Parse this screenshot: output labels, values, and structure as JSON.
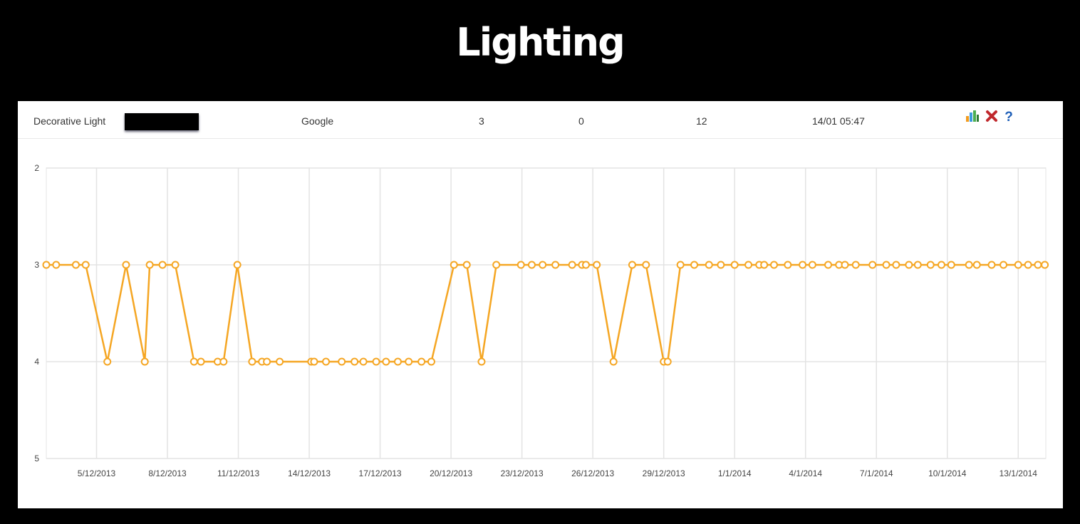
{
  "page_title": "Lighting",
  "row": {
    "name": "Decorative Light",
    "engine": "Google",
    "col3": "3",
    "col4": "0",
    "col5": "12",
    "updated": "14/01 05:47",
    "icons": [
      "bar-chart-icon",
      "close-icon",
      "help-icon"
    ]
  },
  "colors": {
    "series": "#f5a623",
    "background": "#000000",
    "close": "#c0282d",
    "help": "#1f5fb8"
  },
  "chart_data": {
    "type": "line",
    "title": "",
    "xlabel": "",
    "ylabel": "",
    "y_reversed": true,
    "ylim": [
      2,
      5
    ],
    "yticks": [
      "2",
      "3",
      "4",
      "5"
    ],
    "xlim": [
      "2013-12-02T21:00",
      "2014-01-14T04:00"
    ],
    "xticks": [
      {
        "date": "2013-12-05",
        "label": "5/12/2013"
      },
      {
        "date": "2013-12-08",
        "label": "8/12/2013"
      },
      {
        "date": "2013-12-11",
        "label": "11/12/2013"
      },
      {
        "date": "2013-12-14",
        "label": "14/12/2013"
      },
      {
        "date": "2013-12-17",
        "label": "17/12/2013"
      },
      {
        "date": "2013-12-20",
        "label": "20/12/2013"
      },
      {
        "date": "2013-12-23",
        "label": "23/12/2013"
      },
      {
        "date": "2013-12-26",
        "label": "26/12/2013"
      },
      {
        "date": "2013-12-29",
        "label": "29/12/2013"
      },
      {
        "date": "2014-01-01",
        "label": "1/1/2014"
      },
      {
        "date": "2014-01-04",
        "label": "4/1/2014"
      },
      {
        "date": "2014-01-07",
        "label": "7/1/2014"
      },
      {
        "date": "2014-01-10",
        "label": "10/1/2014"
      },
      {
        "date": "2014-01-13",
        "label": "13/1/2014"
      }
    ],
    "grid": true,
    "points": [
      [
        "2013-12-02T21:00",
        3
      ],
      [
        "2013-12-03T07:00",
        3
      ],
      [
        "2013-12-04T03:00",
        3
      ],
      [
        "2013-12-04T13:00",
        3
      ],
      [
        "2013-12-05T11:00",
        4
      ],
      [
        "2013-12-06T06:00",
        3
      ],
      [
        "2013-12-07T01:00",
        4
      ],
      [
        "2013-12-07T06:00",
        3
      ],
      [
        "2013-12-07T19:00",
        3
      ],
      [
        "2013-12-08T08:00",
        3
      ],
      [
        "2013-12-09T03:00",
        4
      ],
      [
        "2013-12-09T10:00",
        4
      ],
      [
        "2013-12-10T03:00",
        4
      ],
      [
        "2013-12-10T09:00",
        4
      ],
      [
        "2013-12-10T23:00",
        3
      ],
      [
        "2013-12-11T14:00",
        4
      ],
      [
        "2013-12-12T00:00",
        4
      ],
      [
        "2013-12-12T05:00",
        4
      ],
      [
        "2013-12-12T18:00",
        4
      ],
      [
        "2013-12-14T02:00",
        4
      ],
      [
        "2013-12-14T05:00",
        4
      ],
      [
        "2013-12-14T17:00",
        4
      ],
      [
        "2013-12-15T09:00",
        4
      ],
      [
        "2013-12-15T22:00",
        4
      ],
      [
        "2013-12-16T07:00",
        4
      ],
      [
        "2013-12-16T20:00",
        4
      ],
      [
        "2013-12-17T06:00",
        4
      ],
      [
        "2013-12-17T18:00",
        4
      ],
      [
        "2013-12-18T05:00",
        4
      ],
      [
        "2013-12-18T18:00",
        4
      ],
      [
        "2013-12-19T04:00",
        4
      ],
      [
        "2013-12-20T03:00",
        3
      ],
      [
        "2013-12-20T16:00",
        3
      ],
      [
        "2013-12-21T07:00",
        4
      ],
      [
        "2013-12-21T22:00",
        3
      ],
      [
        "2013-12-22T23:00",
        3
      ],
      [
        "2013-12-23T10:00",
        3
      ],
      [
        "2013-12-23T21:00",
        3
      ],
      [
        "2013-12-24T10:00",
        3
      ],
      [
        "2013-12-25T03:00",
        3
      ],
      [
        "2013-12-25T13:00",
        3
      ],
      [
        "2013-12-25T17:00",
        3
      ],
      [
        "2013-12-26T04:00",
        3
      ],
      [
        "2013-12-26T21:00",
        4
      ],
      [
        "2013-12-27T16:00",
        3
      ],
      [
        "2013-12-28T06:00",
        3
      ],
      [
        "2013-12-29T00:00",
        4
      ],
      [
        "2013-12-29T04:00",
        4
      ],
      [
        "2013-12-29T17:00",
        3
      ],
      [
        "2013-12-30T07:00",
        3
      ],
      [
        "2013-12-30T22:00",
        3
      ],
      [
        "2013-12-31T10:00",
        3
      ],
      [
        "2014-01-01T00:00",
        3
      ],
      [
        "2014-01-01T14:00",
        3
      ],
      [
        "2014-01-02T01:00",
        3
      ],
      [
        "2014-01-02T06:00",
        3
      ],
      [
        "2014-01-02T16:00",
        3
      ],
      [
        "2014-01-03T06:00",
        3
      ],
      [
        "2014-01-03T21:00",
        3
      ],
      [
        "2014-01-04T07:00",
        3
      ],
      [
        "2014-01-04T23:00",
        3
      ],
      [
        "2014-01-05T10:00",
        3
      ],
      [
        "2014-01-05T16:00",
        3
      ],
      [
        "2014-01-06T03:00",
        3
      ],
      [
        "2014-01-06T20:00",
        3
      ],
      [
        "2014-01-07T10:00",
        3
      ],
      [
        "2014-01-07T20:00",
        3
      ],
      [
        "2014-01-08T09:00",
        3
      ],
      [
        "2014-01-08T18:00",
        3
      ],
      [
        "2014-01-09T07:00",
        3
      ],
      [
        "2014-01-09T18:00",
        3
      ],
      [
        "2014-01-10T04:00",
        3
      ],
      [
        "2014-01-10T22:00",
        3
      ],
      [
        "2014-01-11T06:00",
        3
      ],
      [
        "2014-01-11T21:00",
        3
      ],
      [
        "2014-01-12T09:00",
        3
      ],
      [
        "2014-01-13T00:00",
        3
      ],
      [
        "2014-01-13T10:00",
        3
      ],
      [
        "2014-01-13T20:00",
        3
      ],
      [
        "2014-01-14T03:00",
        3
      ]
    ]
  }
}
